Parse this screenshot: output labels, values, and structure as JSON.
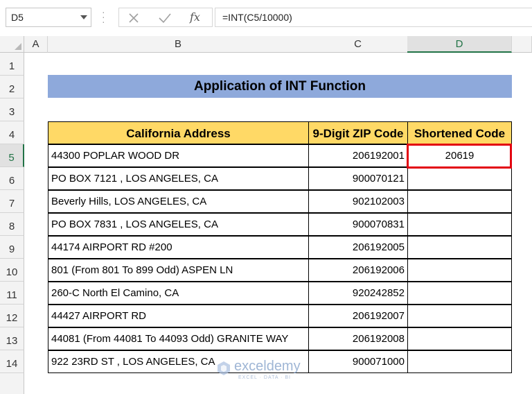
{
  "toolbar": {
    "name_box": "D5",
    "formula": "=INT(C5/10000)",
    "fx_label": "fx"
  },
  "columns": [
    "A",
    "B",
    "C",
    "D"
  ],
  "selected_column": "D",
  "rows": [
    "1",
    "2",
    "3",
    "4",
    "5",
    "6",
    "7",
    "8",
    "9",
    "10",
    "11",
    "12",
    "13",
    "14"
  ],
  "selected_row": "5",
  "sheet": {
    "title": "Application of INT Function",
    "headers": {
      "address": "California Address",
      "zip": "9-Digit ZIP Code",
      "code": "Shortened Code"
    },
    "records": [
      {
        "address": "44300 POPLAR WOOD DR",
        "zip": "206192001",
        "code": "20619"
      },
      {
        "address": "PO BOX 7121 , LOS ANGELES, CA",
        "zip": "900070121",
        "code": ""
      },
      {
        "address": "Beverly Hills,  LOS ANGELES, CA",
        "zip": "902102003",
        "code": ""
      },
      {
        "address": "PO BOX 7831 , LOS ANGELES, CA",
        "zip": "900070831",
        "code": ""
      },
      {
        "address": "44174 AIRPORT RD #200",
        "zip": "206192005",
        "code": ""
      },
      {
        "address": "801 (From 801 To 899 Odd) ASPEN LN",
        "zip": "206192006",
        "code": ""
      },
      {
        "address": "260-C North El Camino, CA",
        "zip": "920242852",
        "code": ""
      },
      {
        "address": "44427 AIRPORT RD",
        "zip": "206192007",
        "code": ""
      },
      {
        "address": "44081 (From 44081 To 44093 Odd) GRANITE WAY",
        "zip": "206192008",
        "code": ""
      },
      {
        "address": "922 23RD ST , LOS ANGELES, CA",
        "zip": "900071000",
        "code": ""
      }
    ]
  },
  "watermark": {
    "name": "exceldemy",
    "tagline": "EXCEL · DATA · BI"
  },
  "colors": {
    "title_fill": "#8ea9db",
    "header_fill": "#ffd966",
    "highlight": "#e3000f",
    "excel_green": "#217346"
  }
}
